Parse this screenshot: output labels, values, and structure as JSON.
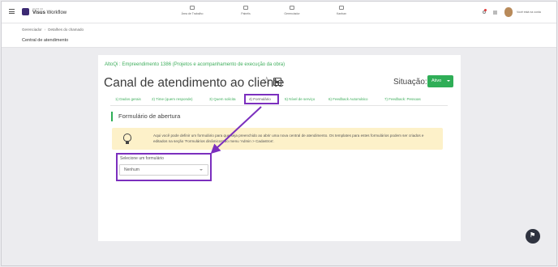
{
  "app": {
    "logo_small": "ALTO QI",
    "logo_text_bold": "Visus",
    "logo_text": " Workflow"
  },
  "nav": [
    {
      "label": "Área de Trabalho",
      "icon": "briefcase-icon"
    },
    {
      "label": "Painéis",
      "icon": "dashboard-icon"
    },
    {
      "label": "Gerenciador",
      "icon": "org-chart-icon"
    },
    {
      "label": "Kanban",
      "icon": "chat-icon"
    }
  ],
  "user": {
    "name": "Você está na conta"
  },
  "breadcrumb": {
    "items": [
      "Gerenciador",
      "Detalhes do chamado"
    ],
    "separator": "›"
  },
  "page_title": "Central de atendimento",
  "card": {
    "project_link": "AltoQi : Empreendimento 1386 (Projetos e acompanhamento de execução da obra)",
    "title": "Canal de atendimento ao cliente",
    "situacao_label": "Situação:",
    "status_value": "Ativo",
    "tabs": [
      "1) Dados gerais",
      "2) Time (quem responde)",
      "3) Quem solicita",
      "4) Formulário",
      "5) Nível de serviço",
      "6) Feedback Automático",
      "7) Feedback: Pessoas"
    ],
    "active_tab_index": 3,
    "section_title": "Formulário de abertura",
    "info_text": "Aqui você pode definir um formulário para que seja preenchido ao abrir uma nova central de atendimento. Os templates para estes formulários podem ser criados e editados na seção 'Formulários dinâmicos' do menu 'Admin > Cadastros'.",
    "select_label": "Selecione um formulário",
    "select_value": "Nenhum"
  },
  "colors": {
    "accent_green": "#2fae57",
    "highlight_purple": "#7b2fbe",
    "info_bg": "#fdf1c9",
    "logo": "#3c2a73"
  }
}
